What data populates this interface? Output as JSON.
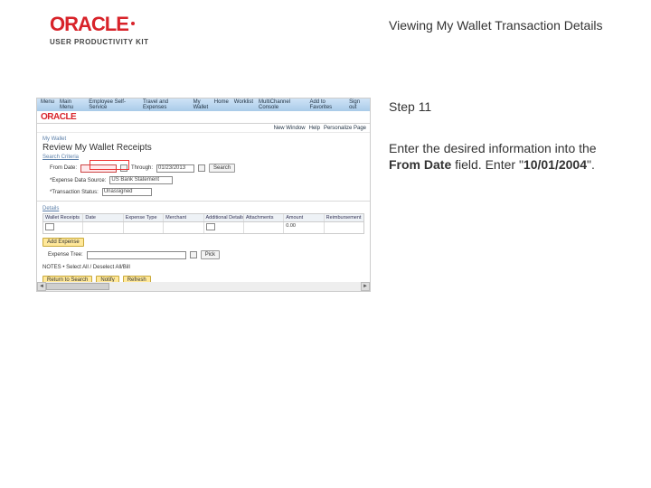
{
  "brand": {
    "name": "ORACLE",
    "productLine": "USER PRODUCTIVITY KIT"
  },
  "doc": {
    "title": "Viewing My Wallet Transaction Details",
    "stepLabel": "Step 11"
  },
  "instruction": {
    "prefix": "Enter the desired information into the ",
    "fieldName": "From Date",
    "middle": " field. Enter \"",
    "value": "10/01/2004",
    "suffix": "\"."
  },
  "ps": {
    "topLeft": [
      "Menu",
      "Main Menu",
      "Employee Self-Service",
      "Travel and Expenses",
      "My Wallet"
    ],
    "topRight": [
      "Home",
      "Worklist",
      "MultiChannel Console",
      "Add to Favorites",
      "Sign out"
    ],
    "userRow": [
      "New Window",
      "Help",
      "Personalize Page"
    ],
    "breadcrumb": "My Wallet",
    "pageTitle": "Review My Wallet Receipts",
    "searchLink": "Search Criteria",
    "search": {
      "fromLabel": "From Date:",
      "fromValue": "",
      "throughLabel": "Through:",
      "throughValue": "01/23/2013",
      "searchBtn": "Search",
      "sourceLabel": "*Expense Data Source:",
      "sourceValue": "US Bank Statement",
      "statusLabel": "*Transaction Status:",
      "statusValue": "Unassigned"
    },
    "detailsLink": "Details",
    "grid": {
      "headers": [
        "Wallet Receipts",
        "Date",
        "Expense Type",
        "Merchant",
        "Additional Details",
        "Attachments",
        "Amount",
        "Reimbursement"
      ],
      "row": {
        "c0": "",
        "c1": "",
        "c2": "",
        "c3": "",
        "c4": "",
        "c5": "",
        "amount": "0.00",
        "reimb": ""
      }
    },
    "addExpense": "Add Expense",
    "treeLabel": "Expense Tree:",
    "treePick": "Pick",
    "note": "NOTES • Select All / Deselect All/Bill",
    "actions": {
      "return": "Return to Search",
      "notify": "Notify",
      "refresh": "Refresh"
    }
  }
}
